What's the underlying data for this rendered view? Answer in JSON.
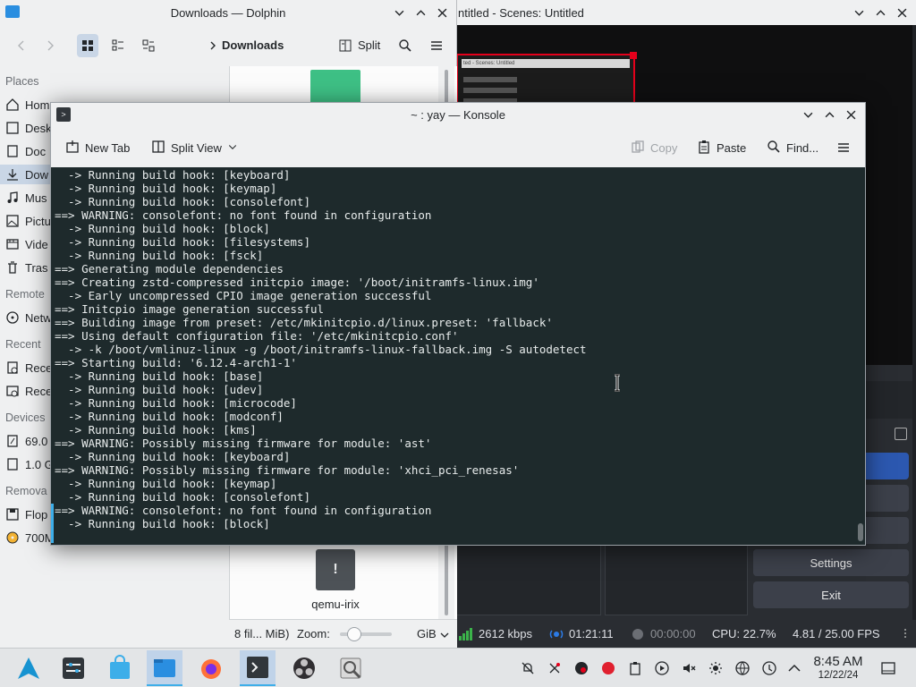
{
  "obs": {
    "title": "ntitled - Scenes: Untitled",
    "mini_title": "ted - Scenes: Untitled",
    "buttons": {
      "settings": "Settings",
      "exit": "Exit"
    },
    "status": {
      "bitrate": "2612 kbps",
      "stream_time": "01:21:11",
      "rec_time": "00:00:00",
      "cpu": "CPU: 22.7%",
      "fps": "4.81 / 25.00 FPS"
    }
  },
  "dolphin": {
    "title": "Downloads — Dolphin",
    "breadcrumb": "Downloads",
    "split_label": "Split",
    "places": {
      "header_places": "Places",
      "header_remote": "Remote",
      "header_recent": "Recent",
      "header_devices": "Devices",
      "header_removable": "Remova",
      "items": {
        "home": "Hom",
        "desktop": "Desk",
        "documents": "Doc",
        "downloads": "Dow",
        "music": "Mus",
        "pictures": "Pictu",
        "videos": "Vide",
        "trash": "Tras",
        "network": "Netw",
        "recent1": "Rece",
        "recent2": "Rece",
        "device1": "69.0",
        "device2": "1.0 G",
        "floppy": "Flop",
        "cdrom": "700M"
      }
    },
    "file_name": "qemu-irix",
    "status_text": "8 fil... MiB)",
    "zoom_label": "Zoom:",
    "unit": "GiB"
  },
  "konsole": {
    "title": "~ : yay — Konsole",
    "toolbar": {
      "new_tab": "New Tab",
      "split_view": "Split View",
      "copy": "Copy",
      "paste": "Paste",
      "find": "Find..."
    },
    "lines": [
      "  -> Running build hook: [keyboard]",
      "  -> Running build hook: [keymap]",
      "  -> Running build hook: [consolefont]",
      "==> WARNING: consolefont: no font found in configuration",
      "  -> Running build hook: [block]",
      "  -> Running build hook: [filesystems]",
      "  -> Running build hook: [fsck]",
      "==> Generating module dependencies",
      "==> Creating zstd-compressed initcpio image: '/boot/initramfs-linux.img'",
      "  -> Early uncompressed CPIO image generation successful",
      "==> Initcpio image generation successful",
      "==> Building image from preset: /etc/mkinitcpio.d/linux.preset: 'fallback'",
      "==> Using default configuration file: '/etc/mkinitcpio.conf'",
      "  -> -k /boot/vmlinuz-linux -g /boot/initramfs-linux-fallback.img -S autodetect",
      "==> Starting build: '6.12.4-arch1-1'",
      "  -> Running build hook: [base]",
      "  -> Running build hook: [udev]",
      "  -> Running build hook: [microcode]",
      "  -> Running build hook: [modconf]",
      "  -> Running build hook: [kms]",
      "==> WARNING: Possibly missing firmware for module: 'ast'",
      "  -> Running build hook: [keyboard]",
      "==> WARNING: Possibly missing firmware for module: 'xhci_pci_renesas'",
      "  -> Running build hook: [keymap]",
      "  -> Running build hook: [consolefont]",
      "==> WARNING: consolefont: no font found in configuration",
      "  -> Running build hook: [block]"
    ]
  },
  "clock": {
    "time": "8:45 AM",
    "date": "12/22/24"
  },
  "colors": {
    "accent": "#3daee9",
    "terminal_bg": "#1e2a2c",
    "obs_red": "#e5001b"
  }
}
